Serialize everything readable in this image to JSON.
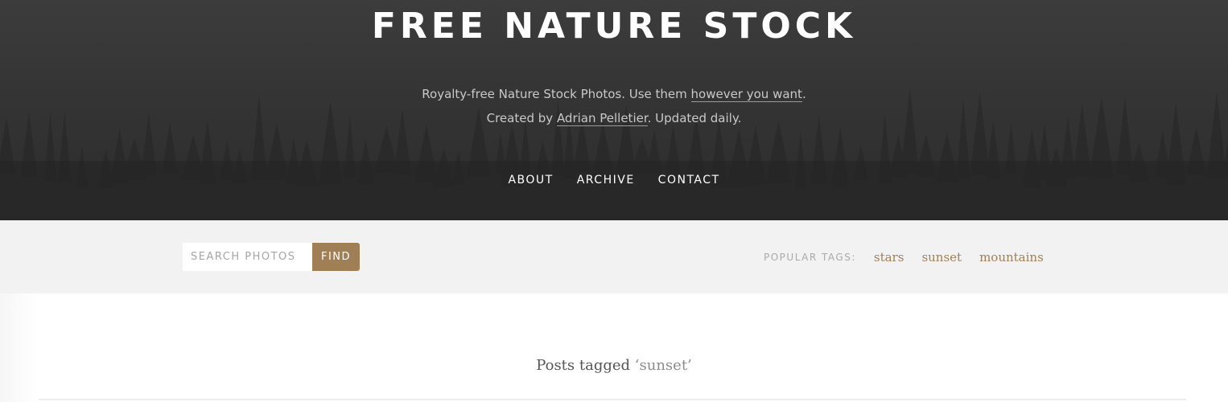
{
  "header": {
    "title": "FREE NATURE STOCK",
    "tagline": {
      "line1_prefix": "Royalty-free Nature Stock Photos. Use them ",
      "line1_link": "however you want",
      "line1_suffix": ".",
      "line2_prefix": "Created by ",
      "line2_link": "Adrian Pelletier",
      "line2_suffix": ". Updated daily."
    },
    "nav": [
      {
        "label": "ABOUT"
      },
      {
        "label": "ARCHIVE"
      },
      {
        "label": "CONTACT"
      }
    ]
  },
  "search": {
    "placeholder": "SEARCH PHOTOS",
    "value": "",
    "button_label": "FIND"
  },
  "popular_tags": {
    "label": "POPULAR TAGS:",
    "tags": [
      "stars",
      "sunset",
      "mountains"
    ]
  },
  "main": {
    "heading_prefix": "Posts tagged ",
    "heading_tag": "‘sunset’"
  },
  "colors": {
    "accent": "#a17f56",
    "header_bg": "#333333",
    "toolbar_bg": "#f2f2f2"
  }
}
